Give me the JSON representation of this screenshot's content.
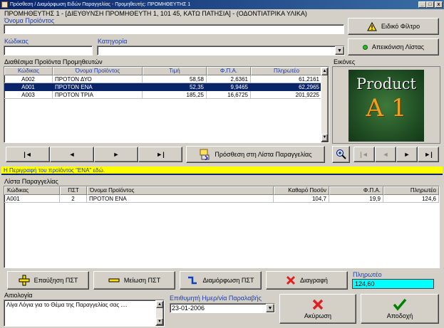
{
  "window": {
    "title": "Πρόσθεση / Διαμόρφωση Ειδών Παραγγελίας - Προμηθευτής: ΠΡΟΜΗΘΕΥΤΗΣ 1",
    "minimize": "_",
    "maximize": "□",
    "close": "x"
  },
  "supplier_line": "ΠΡΟΜΗΘΕΥΤΗΣ 1 - [ΔΙΕΥΘΥΝΣΗ ΠΡΟΜΗΘΕΥΤΗ 1, 101 45, ΚΑΤΩ ΠΑΤΗΣΙΑ] - (ΟΔΟΝΤΙΑΤΡΙΚΑ ΥΛΙΚΑ)",
  "filters": {
    "name_label": "Όνομα Προϊόντος",
    "name_value": "",
    "code_label": "Κώδικας",
    "code_value": "",
    "category_label": "Κατηγορία",
    "category_value": ""
  },
  "buttons": {
    "special_filter": "Ειδικό Φίλτρο",
    "show_list": "Απεικόνιση Λίστας",
    "add_to_order": "Πρόσθεση στη Λίστα Παραγγελίας",
    "increase": "Επαύξηση ΠΣΤ",
    "decrease": "Μείωση ΠΣΤ",
    "configure": "Διαμόρφωση ΠΣΤ",
    "delete": "Διαγραφή",
    "cancel": "Ακύρωση",
    "accept": "Αποδοχή"
  },
  "available": {
    "title": "Διαθέσιμα Προϊόντα Προμηθευτών",
    "headers": [
      "Κώδικας",
      "Όνομα Προϊόντος",
      "Τιμή",
      "Φ.Π.Α.",
      "Πληρωτέο"
    ],
    "rows": [
      [
        "A002",
        "ΠΡΟΤΟΝ ΔΥΟ",
        "58,58",
        "2,6361",
        "61,2161"
      ],
      [
        "A001",
        "ΠΡΟΤΟΝ ΕΝΑ",
        "52,35",
        "9,9465",
        "62,2965"
      ],
      [
        "A003",
        "ΠΡΟΤΟΝ ΤΡΙΑ",
        "185,25",
        "16,6725",
        "201,9225"
      ]
    ],
    "selected_index": 1
  },
  "images": {
    "title": "Εικόνες",
    "product_word": "Product",
    "product_code": "A 1"
  },
  "nav": {
    "first": "|◄",
    "prev": "◄",
    "next": "►",
    "last": "►|"
  },
  "description": "Η Περιγραφή του προϊόντος \"ΕΝΑ\" εδώ.",
  "order": {
    "title": "Λίστα Παραγγελίας",
    "headers": [
      "Κώδικας",
      "ΠΣΤ",
      "Όνομα Προϊόντος",
      "Καθαρό Ποσόν",
      "Φ.Π.Α.",
      "Πληρωτέο"
    ],
    "rows": [
      [
        "A001",
        "2",
        "ΠΡΟΤΟΝ ΕΝΑ",
        "104,7",
        "19,9",
        "124,6"
      ]
    ]
  },
  "total": {
    "label": "Πληρωτέο",
    "value": "124,60"
  },
  "reason": {
    "label": "Αιτιολογία",
    "value": "Λίγα Λόγια για το Θέμα της Παραγγελίας σας ...."
  },
  "delivery": {
    "label": "Επιθυμητή Ημερ/νία Παραλαβής",
    "value": "23-01-2006"
  },
  "colors": {
    "selection": "#0a246a",
    "description_bg": "#ffff00",
    "total_bg": "#00ffff",
    "title_blue": "#1c3ca8"
  }
}
